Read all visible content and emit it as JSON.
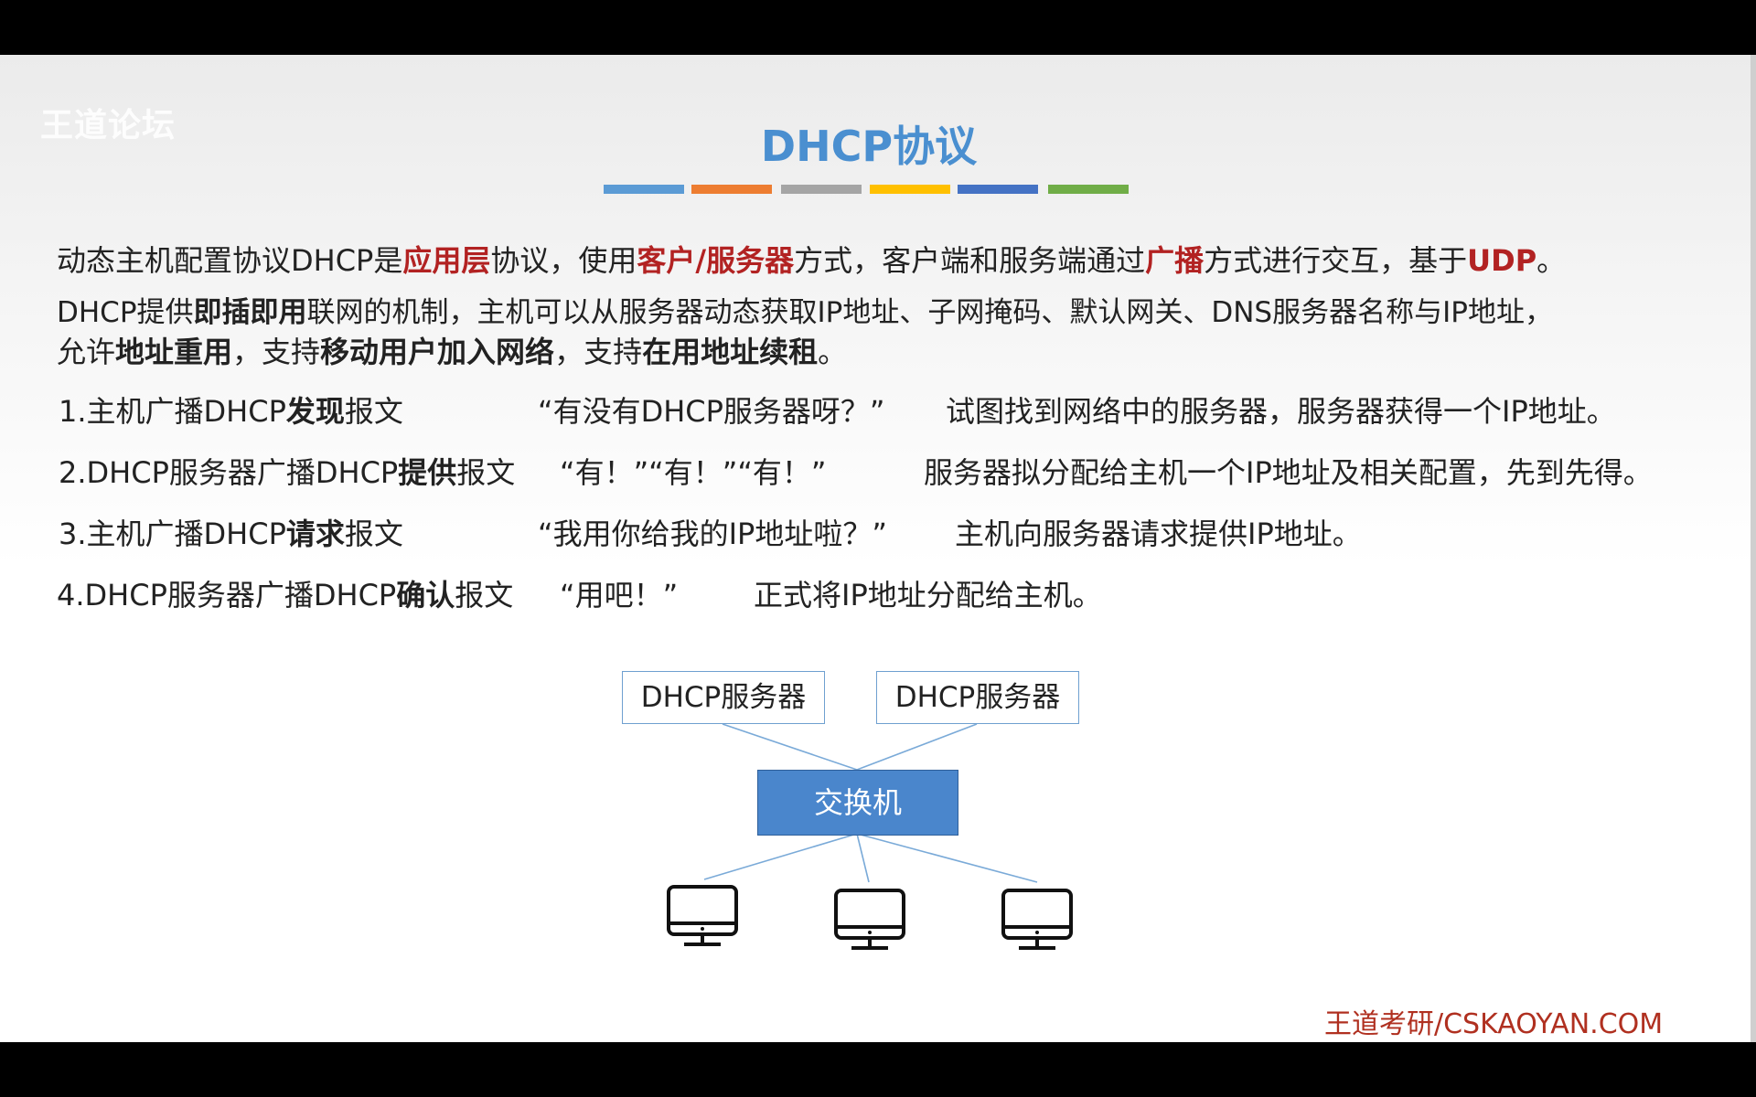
{
  "watermark": {
    "main": "王道论坛",
    "sub": ""
  },
  "title": "DHCP协议",
  "title_bar_colors": [
    "#5b9bd5",
    "#ed7d31",
    "#a5a5a5",
    "#ffc000",
    "#4472c4",
    "#70ad47"
  ],
  "para1": {
    "s1": "动态主机配置协议DHCP是",
    "h1": "应用层",
    "s2": "协议，使用",
    "h2": "客户/服务器",
    "s3": "方式，客户端和服务端通过",
    "h3": "广播",
    "s4": "方式进行交互，基于",
    "h4": "UDP",
    "s5": "。"
  },
  "para2": {
    "s1": "DHCP提供",
    "b1": "即插即用",
    "s2": "联网的机制，主机可以从服务器动态获取IP地址、子网掩码、默认网关、DNS服务器名称与IP地址，",
    "s3": "允许",
    "b2": "地址重用",
    "s4": "，支持",
    "b3": "移动用户加入网络",
    "s5": "，支持",
    "b4": "在用地址续租",
    "s6": "。"
  },
  "steps": [
    {
      "pre": "1.主机广播DHCP",
      "bold": "发现",
      "post": "报文",
      "quote": "“有没有DHCP服务器呀？”",
      "desc": "试图找到网络中的服务器，服务器获得一个IP地址。"
    },
    {
      "pre": "2.DHCP服务器广播DHCP",
      "bold": "提供",
      "post": "报文",
      "quote": "“有！”“有！”“有！”",
      "desc": "服务器拟分配给主机一个IP地址及相关配置，先到先得。"
    },
    {
      "pre": "3.主机广播DHCP",
      "bold": "请求",
      "post": "报文",
      "quote": "“我用你给我的IP地址啦？”",
      "desc": "主机向服务器请求提供IP地址。"
    },
    {
      "pre": "4.DHCP服务器广播DHCP",
      "bold": "确认",
      "post": "报文",
      "quote": "“用吧！”",
      "desc": "正式将IP地址分配给主机。"
    }
  ],
  "diagram": {
    "servers": [
      "DHCP服务器",
      "DHCP服务器"
    ],
    "switch": "交换机",
    "hosts": [
      "monitor-icon",
      "monitor-icon",
      "monitor-icon"
    ]
  },
  "footer": "王道考研/CSKAOYAN.COM"
}
